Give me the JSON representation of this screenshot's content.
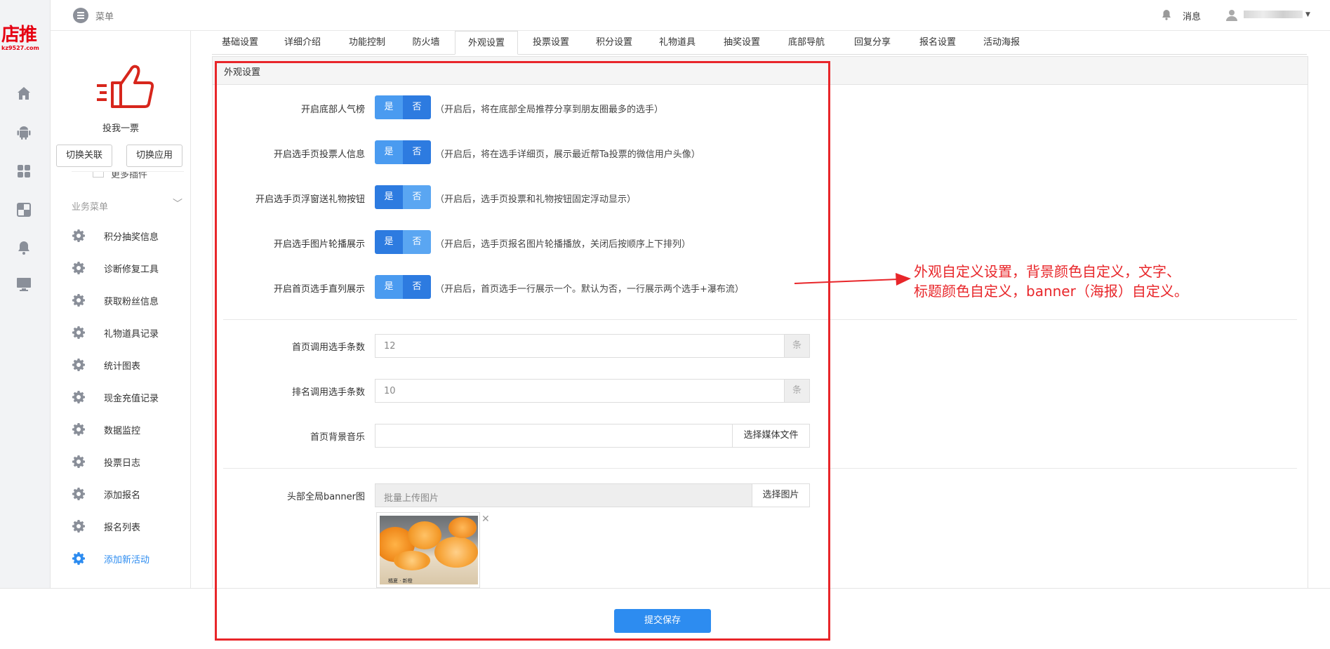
{
  "brand": {
    "logo_text": "店推",
    "logo_sub": "kz9527.com",
    "accent": "#2d8cf0",
    "annot_color": "#e8262a"
  },
  "topbar": {
    "menu_label": "菜单",
    "messages_label": "消息"
  },
  "app": {
    "name": "投我一票",
    "switch_link": "切换关联",
    "switch_app": "切换应用",
    "partial_item": "更多插件"
  },
  "sidebar": {
    "section": "业务菜单",
    "items": [
      {
        "label": "积分抽奖信息"
      },
      {
        "label": "诊断修复工具"
      },
      {
        "label": "获取粉丝信息"
      },
      {
        "label": "礼物道具记录"
      },
      {
        "label": "统计图表"
      },
      {
        "label": "现金充值记录"
      },
      {
        "label": "数据监控"
      },
      {
        "label": "投票日志"
      },
      {
        "label": "添加报名"
      },
      {
        "label": "报名列表"
      },
      {
        "label": "添加新活动"
      }
    ]
  },
  "tabs": [
    "基础设置",
    "详细介绍",
    "功能控制",
    "防火墙",
    "外观设置",
    "投票设置",
    "积分设置",
    "礼物道具",
    "抽奖设置",
    "底部导航",
    "回复分享",
    "报名设置",
    "活动海报"
  ],
  "panel": {
    "title": "外观设置",
    "yes": "是",
    "no": "否",
    "toggles": [
      {
        "label": "开启底部人气榜",
        "hint": "（开启后，将在底部全局推荐分享到朋友圈最多的选手）"
      },
      {
        "label": "开启选手页投票人信息",
        "hint": "（开启后，将在选手详细页，展示最近帮Ta投票的微信用户头像）"
      },
      {
        "label": "开启选手页浮窗送礼物按钮",
        "hint": "（开启后，选手页投票和礼物按钮固定浮动显示）"
      },
      {
        "label": "开启选手图片轮播展示",
        "hint": "（开启后，选手页报名图片轮播播放，关闭后按顺序上下排列）"
      },
      {
        "label": "开启首页选手直列展示",
        "hint": "（开启后，首页选手一行展示一个。默认为否，一行展示两个选手+瀑布流）"
      }
    ],
    "home_count": {
      "label": "首页调用选手条数",
      "value": "12",
      "unit": "条"
    },
    "rank_count": {
      "label": "排名调用选手条数",
      "value": "10",
      "unit": "条"
    },
    "music": {
      "label": "首页背景音乐",
      "button": "选择媒体文件"
    },
    "banner": {
      "label": "头部全局banner图",
      "placeholder": "批量上传图片",
      "button": "选择图片",
      "thumb_caption": "橘夏 · 新橙"
    },
    "save": "提交保存"
  },
  "annotation": {
    "line1": "外观自定义设置，背景颜色自定义，文字、",
    "line2": "标题颜色自定义，banner（海报）自定义。"
  }
}
